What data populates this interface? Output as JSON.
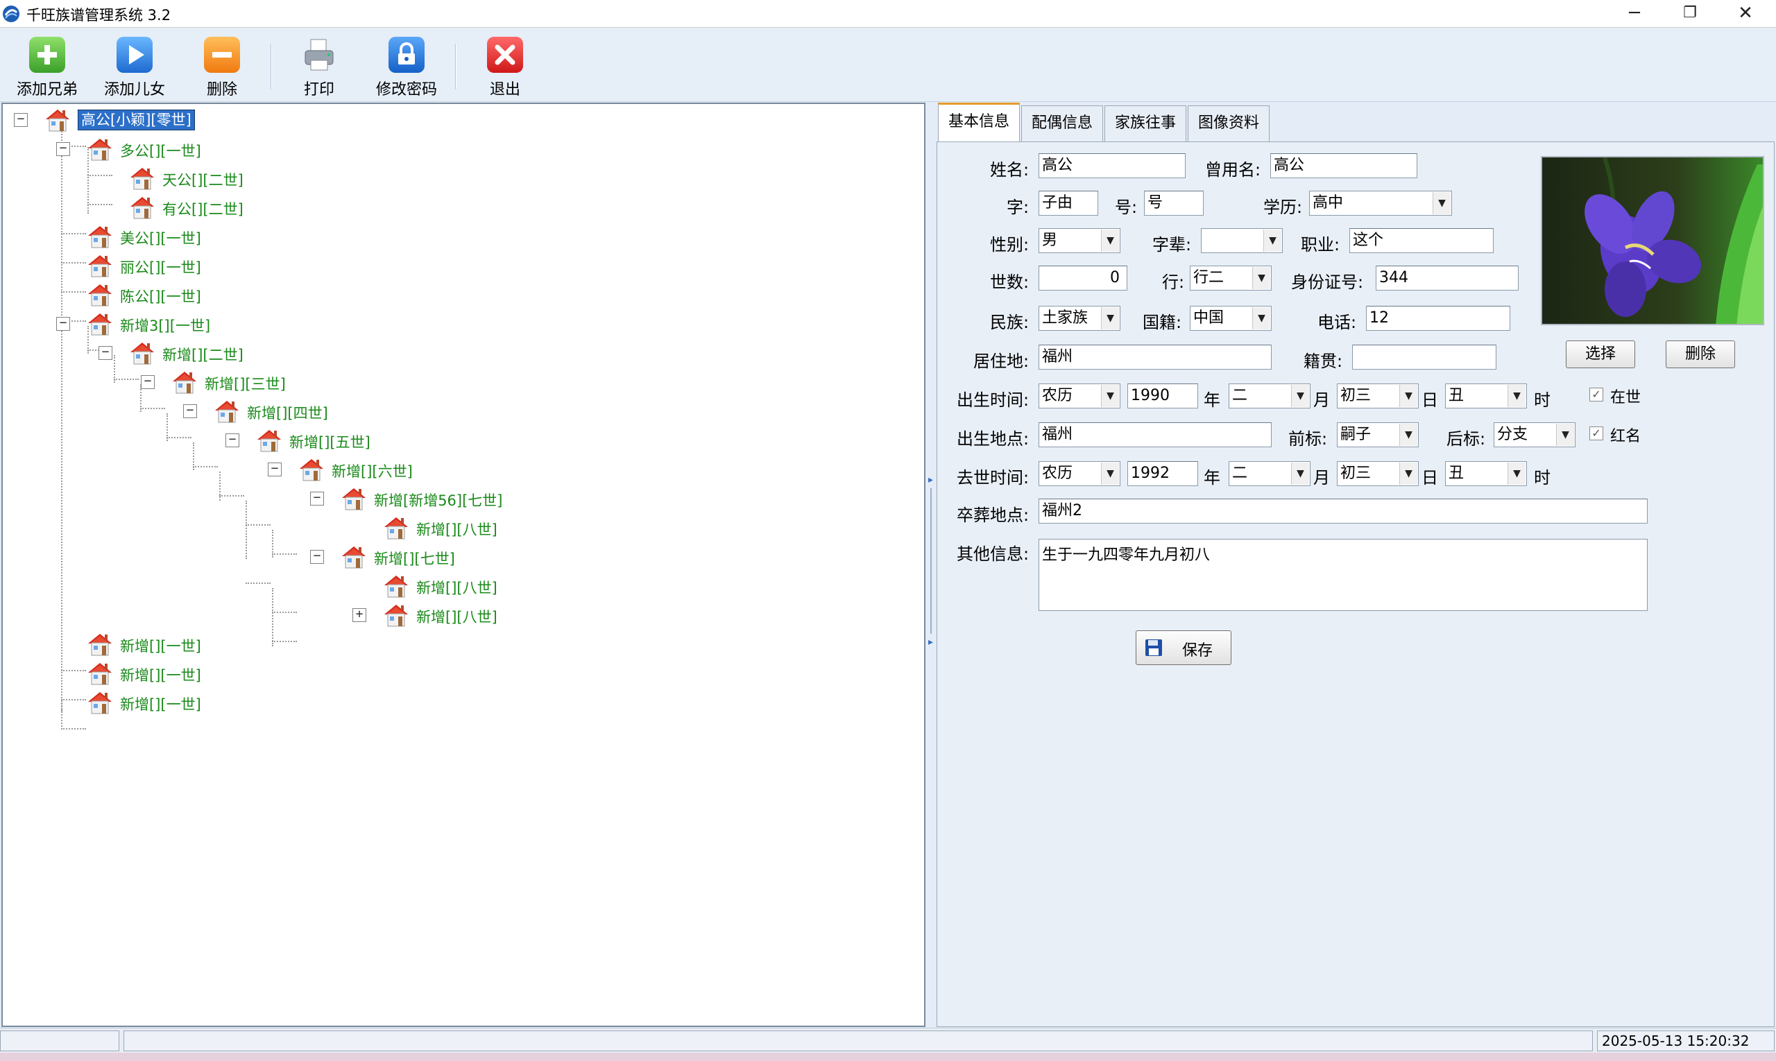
{
  "window": {
    "title": "千旺族谱管理系统 3.2",
    "minimize": "─",
    "maximize": "❐",
    "close": "✕"
  },
  "toolbar": {
    "add_sibling": "添加兄弟",
    "add_child": "添加儿女",
    "delete": "删除",
    "print": "打印",
    "change_password": "修改密码",
    "exit": "退出"
  },
  "tree": {
    "root": "高公[小颖][零世]",
    "nodes": [
      "多公[][一世]",
      "天公[][二世]",
      "有公[][二世]",
      "美公[][一世]",
      "丽公[][一世]",
      "陈公[][一世]",
      "新增3[][一世]",
      "新增[][二世]",
      "新增[][三世]",
      "新增[][四世]",
      "新增[][五世]",
      "新增[][六世]",
      "新增[新增56][七世]",
      "新增[][八世]",
      "新增[][七世]",
      "新增[][八世]",
      "新增[][八世]",
      "新增[][一世]",
      "新增[][一世]",
      "新增[][一世]"
    ],
    "expand_minus": "−",
    "expand_plus": "+"
  },
  "tabs": [
    "基本信息",
    "配偶信息",
    "家族往事",
    "图像资料"
  ],
  "form": {
    "name_label": "姓名:",
    "name": "高公",
    "former_name_label": "曾用名:",
    "former_name": "高公",
    "zi_label": "字:",
    "zi": "子由",
    "hao_label": "号:",
    "hao": "号",
    "education_label": "学历:",
    "education": "高中",
    "gender_label": "性别:",
    "gender": "男",
    "generation_name_label": "字辈:",
    "generation_name": "",
    "occupation_label": "职业:",
    "occupation": "这个",
    "generation_label": "世数:",
    "generation": "0",
    "rank_label": "行:",
    "rank": "行二",
    "id_label": "身份证号:",
    "id_number": "344",
    "ethnicity_label": "民族:",
    "ethnicity": "土家族",
    "nationality_label": "国籍:",
    "nationality": "中国",
    "phone_label": "电话:",
    "phone": "12",
    "residence_label": "居住地:",
    "residence": "福州",
    "native_label": "籍贯:",
    "native_place": "",
    "birth_time_label": "出生时间:",
    "birth_calendar": "农历",
    "birth_year": "1990",
    "year_unit": "年",
    "birth_month": "二",
    "month_unit": "月",
    "birth_day": "初三",
    "day_unit": "日",
    "birth_hour": "丑",
    "hour_unit": "时",
    "alive_label": "在世",
    "birth_place_label": "出生地点:",
    "birth_place": "福州",
    "prefix_label": "前标:",
    "prefix": "嗣子",
    "suffix_label": "后标:",
    "suffix": "分支",
    "red_name_label": "红名",
    "death_time_label": "去世时间:",
    "death_calendar": "农历",
    "death_year": "1992",
    "death_month": "二",
    "death_day": "初三",
    "death_hour": "丑",
    "burial_label": "卒葬地点:",
    "burial_place": "福州2",
    "other_label": "其他信息:",
    "other_info": "生于一九四零年九月初八",
    "photo_select": "选择",
    "photo_delete": "删除",
    "save": "保存",
    "checkmark": "✓",
    "dropdown_arrow": "▼"
  },
  "status": {
    "datetime": "2025-05-13  15:20:32"
  },
  "colors": {
    "tree_text": "#1a8a1a",
    "selection": "#2b6fc9",
    "active_tab_accent": "#e89a2a"
  }
}
